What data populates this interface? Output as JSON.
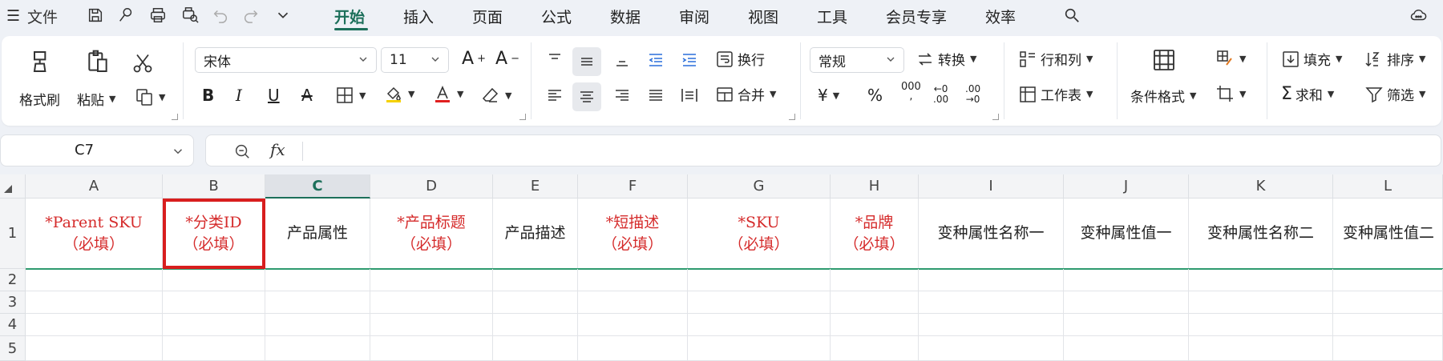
{
  "menu": {
    "file": "文件",
    "tabs": [
      "开始",
      "插入",
      "页面",
      "公式",
      "数据",
      "审阅",
      "视图",
      "工具",
      "会员专享",
      "效率"
    ],
    "active_tab": "开始"
  },
  "ribbon": {
    "format_painter": "格式刷",
    "paste": "粘贴",
    "font_name": "宋体",
    "font_size": "11",
    "wrap": "换行",
    "merge": "合并",
    "number_format": "常规",
    "convert": "转换",
    "rows_cols": "行和列",
    "worksheet": "工作表",
    "cond_format": "条件格式",
    "fill": "填充",
    "sort": "排序",
    "sum": "求和",
    "filter": "筛选",
    "currency_symbol": "¥",
    "percent_symbol": "%",
    "thousands_symbol": "000",
    "inc_decimal": "←0\n.00",
    "dec_decimal": ".00\n→0",
    "accent": "#1c6f5a"
  },
  "formula_bar": {
    "cell_ref": "C7",
    "fx": "fx"
  },
  "grid": {
    "columns": [
      "A",
      "B",
      "C",
      "D",
      "E",
      "F",
      "G",
      "H",
      "I",
      "J",
      "K",
      "L"
    ],
    "selected_column": "C",
    "rows": [
      "1",
      "2",
      "3",
      "4",
      "5"
    ],
    "header_cells": [
      {
        "line1": "*Parent SKU",
        "line2": "（必填）",
        "required": true
      },
      {
        "line1": "*分类ID",
        "line2": "（必填）",
        "required": true
      },
      {
        "line1": "产品属性",
        "line2": "",
        "required": false
      },
      {
        "line1": "*产品标题",
        "line2": "（必填）",
        "required": true
      },
      {
        "line1": "产品描述",
        "line2": "",
        "required": false
      },
      {
        "line1": "*短描述",
        "line2": "（必填）",
        "required": true
      },
      {
        "line1": "*SKU",
        "line2": "（必填）",
        "required": true
      },
      {
        "line1": "*品牌",
        "line2": "（必填）",
        "required": true
      },
      {
        "line1": "变种属性名称一",
        "line2": "",
        "required": false
      },
      {
        "line1": "变种属性值一",
        "line2": "",
        "required": false
      },
      {
        "line1": "变种属性名称二",
        "line2": "",
        "required": false
      },
      {
        "line1": "变种属性值二",
        "line2": "",
        "required": false
      }
    ],
    "required_color": "#d52b2b",
    "highlight_color": "#d81e1e"
  }
}
